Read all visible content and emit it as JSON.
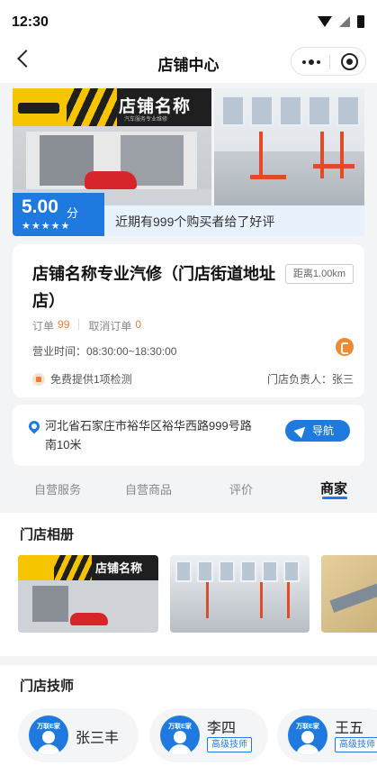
{
  "status_bar": {
    "time": "12:30"
  },
  "nav": {
    "title": "店铺中心"
  },
  "banner": {
    "store_sign": "店铺名称",
    "sign_subtitle": "汽车服务专业维修",
    "rating_value": "5.00",
    "rating_unit": "分",
    "rating_stars": 5,
    "stars_text": "★★★★★",
    "review_summary": "近期有999个购买者给了好评"
  },
  "store": {
    "name": "店铺名称专业汽修（门店街道地址店）",
    "distance": "距离1.00km",
    "orders_label": "订单",
    "orders_count": "99",
    "cancel_label": "取消订单",
    "cancel_count": "0",
    "hours": "营业时间：08:30:00~18:30:00",
    "free_offer": "免费提供1项检测",
    "manager": "门店负责人：张三"
  },
  "address": {
    "text": "河北省石家庄市裕华区裕华西路999号路南10米",
    "nav_button": "导航"
  },
  "tabs": [
    {
      "label": "自营服务"
    },
    {
      "label": "自营商品"
    },
    {
      "label": "评价"
    },
    {
      "label": "商家"
    }
  ],
  "active_tab": "商家",
  "album": {
    "title": "门店相册",
    "thumb_sign": "店铺名称"
  },
  "technicians": {
    "title": "门店技师",
    "avatar_brand": "万联E家",
    "items": [
      {
        "name": "张三丰",
        "level": ""
      },
      {
        "name": "李四",
        "level": "高级技师"
      },
      {
        "name": "王五",
        "level": "高级技师"
      }
    ]
  },
  "colors": {
    "accent": "#1f7ae0",
    "orange": "#f07a3c",
    "yellow": "#f6c500"
  }
}
